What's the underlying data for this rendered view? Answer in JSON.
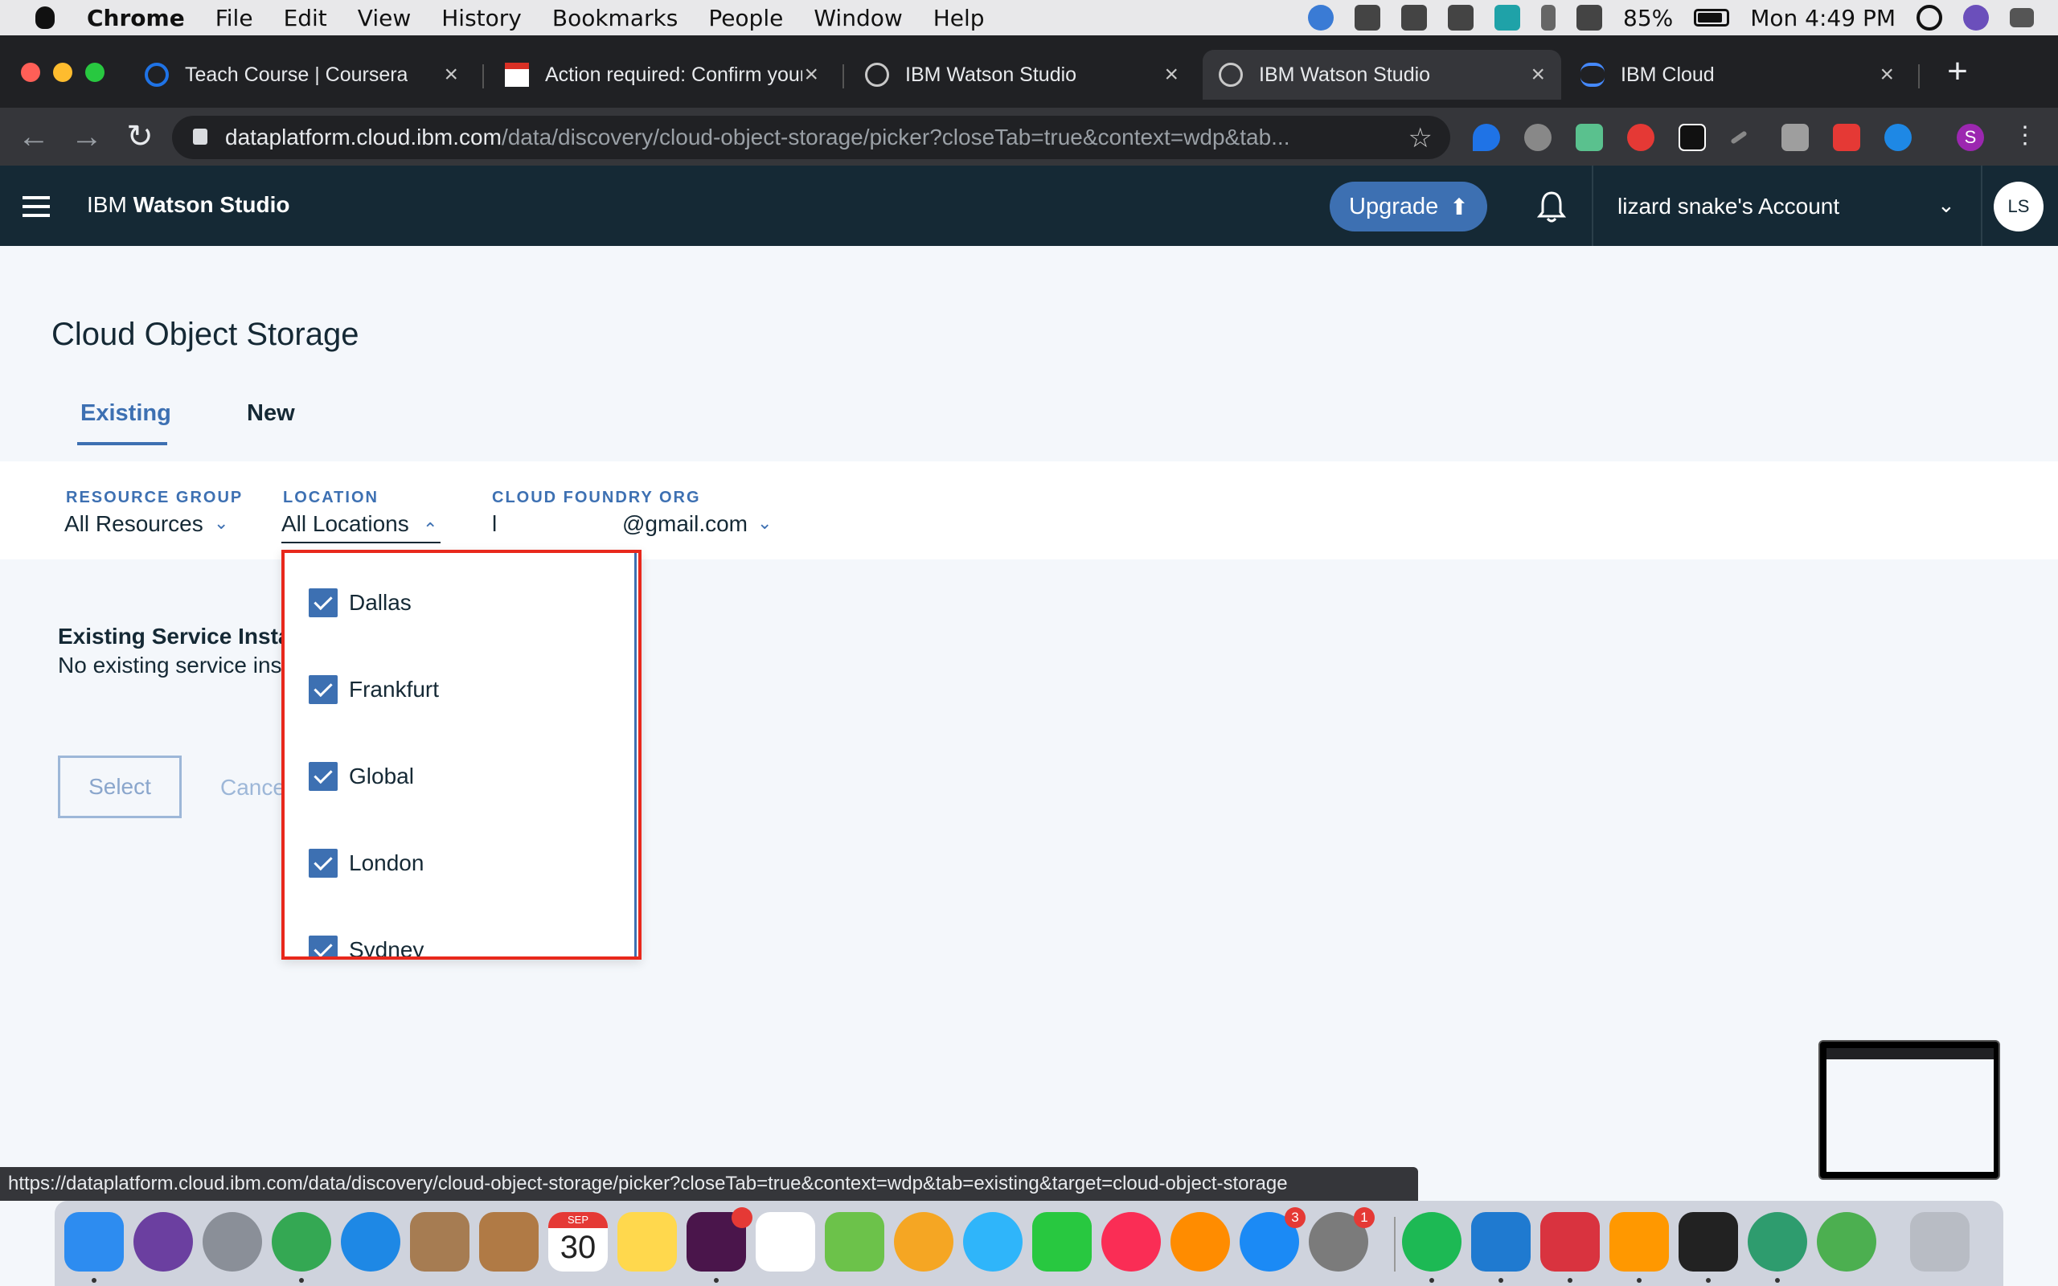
{
  "menubar": {
    "items": [
      "Chrome",
      "File",
      "Edit",
      "View",
      "History",
      "Bookmarks",
      "People",
      "Window",
      "Help"
    ],
    "battery": "85%",
    "clock": "Mon 4:49 PM"
  },
  "browser": {
    "tabs": [
      {
        "label": "Teach Course | Coursera",
        "icon": "coursera-icon",
        "color": "#1f73e6"
      },
      {
        "label": "Action required: Confirm your",
        "icon": "gmail-icon",
        "color": "#d93025"
      },
      {
        "label": "IBM Watson Studio",
        "icon": "watson-icon",
        "color": "#c8c8c8"
      },
      {
        "label": "IBM Watson Studio",
        "icon": "watson-icon",
        "color": "#c8c8c8"
      },
      {
        "label": "IBM Cloud",
        "icon": "ibm-cloud-icon",
        "color": "#4589ff"
      }
    ],
    "active_tab": 3,
    "url_host": "dataplatform.cloud.ibm.com",
    "url_path": "/data/discovery/cloud-object-storage/picker?closeTab=true&context=wdp&tab...",
    "status_url": "https://dataplatform.cloud.ibm.com/data/discovery/cloud-object-storage/picker?closeTab=true&context=wdp&tab=existing&target=cloud-object-storage",
    "profile_initial": "S"
  },
  "app_header": {
    "brand_prefix": "IBM",
    "brand_name": "Watson Studio",
    "upgrade_label": "Upgrade",
    "account_name": "lizard snake's Account",
    "avatar_initials": "LS"
  },
  "page": {
    "title": "Cloud Object Storage",
    "tabs": [
      {
        "label": "Existing",
        "selected": true
      },
      {
        "label": "New",
        "selected": false
      }
    ],
    "filters": {
      "resource_group": {
        "label": "RESOURCE GROUP",
        "value": "All Resources"
      },
      "location": {
        "label": "LOCATION",
        "value": "All Locations"
      },
      "cloud_foundry_org": {
        "label": "CLOUD FOUNDRY ORG",
        "value_prefix": "l",
        "value_suffix": "@gmail.com"
      }
    },
    "existing_title": "Existing Service Insta",
    "existing_desc": "No existing service ins",
    "select_label": "Select",
    "cancel_label": "Cance"
  },
  "location_dropdown": {
    "options": [
      {
        "label": "Dallas",
        "checked": true
      },
      {
        "label": "Frankfurt",
        "checked": true
      },
      {
        "label": "Global",
        "checked": true
      },
      {
        "label": "London",
        "checked": true
      },
      {
        "label": "Sydney",
        "checked": true
      }
    ]
  },
  "dock": {
    "apps": [
      {
        "name": "finder",
        "color": "#2d8cf0"
      },
      {
        "name": "siri",
        "color": "#6b3fa0"
      },
      {
        "name": "launchpad",
        "color": "#8a8f98"
      },
      {
        "name": "chrome",
        "color": "#34a853"
      },
      {
        "name": "safari",
        "color": "#1e88e5"
      },
      {
        "name": "preview",
        "color": "#a67c52"
      },
      {
        "name": "contacts",
        "color": "#b07a45"
      },
      {
        "name": "calendar",
        "color": "#ffffff"
      },
      {
        "name": "notes",
        "color": "#ffd84d"
      },
      {
        "name": "slack",
        "color": "#4a154b"
      },
      {
        "name": "reminders",
        "color": "#ffffff"
      },
      {
        "name": "maps",
        "color": "#6cc24a"
      },
      {
        "name": "photos",
        "color": "#f5a623"
      },
      {
        "name": "messages",
        "color": "#2fb5fa"
      },
      {
        "name": "facetime",
        "color": "#28c840"
      },
      {
        "name": "music",
        "color": "#fa2d55"
      },
      {
        "name": "books",
        "color": "#ff8c00"
      },
      {
        "name": "app-store",
        "color": "#1b8af5"
      },
      {
        "name": "system-preferences",
        "color": "#7b7b7b"
      },
      {
        "name": "spotify",
        "color": "#1db954"
      },
      {
        "name": "vscode",
        "color": "#1f7ad0"
      },
      {
        "name": "bear",
        "color": "#d9333f"
      },
      {
        "name": "sublime-text",
        "color": "#ff9800"
      },
      {
        "name": "terminal",
        "color": "#222222"
      },
      {
        "name": "atom",
        "color": "#2e9c6e"
      },
      {
        "name": "network-utility",
        "color": "#4caf50"
      },
      {
        "name": "trash",
        "color": "#b8bcc4"
      }
    ],
    "calendar_month": "SEP",
    "calendar_day": "30",
    "slack_badge": "",
    "appstore_badge": "3",
    "sysprefs_badge": "1"
  }
}
